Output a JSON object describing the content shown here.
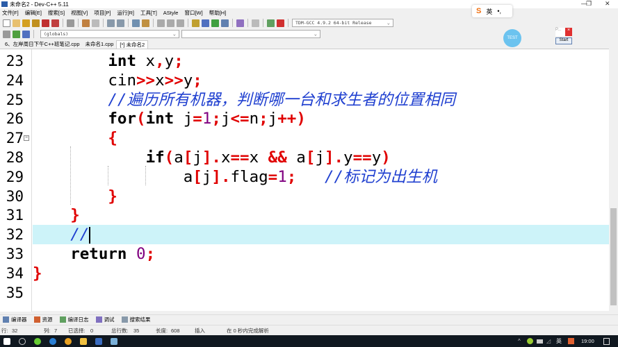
{
  "window": {
    "title": "未命名2 - Dev-C++ 5.11",
    "minimize": "—",
    "maximize": "❐",
    "close": "✕"
  },
  "menu": [
    "文件[F]",
    "编辑[E]",
    "搜索[S]",
    "视图[V]",
    "项目[P]",
    "运行[R]",
    "工具[T]",
    "AStyle",
    "窗口[W]",
    "帮助[H]"
  ],
  "toolbar": {
    "compiler": "TDM-GCC 4.9.2 64-bit Release",
    "scope": "(globals)"
  },
  "tabs": [
    {
      "label": "6、左岸周日下午C++班笔记.cpp",
      "active": false
    },
    {
      "label": "未命名1.cpp",
      "active": false
    },
    {
      "label": "[*] 未命名2",
      "active": true
    }
  ],
  "overlay": {
    "ime_mode": "英",
    "ime_dots": "•,",
    "test_label": "TEST",
    "mini_title": "P...",
    "mini_close": "×",
    "mini_start": "Start"
  },
  "editor": {
    "lines": [
      {
        "n": "23",
        "indent": 8,
        "tokens": [
          [
            "int",
            "kw"
          ],
          [
            " x",
            "id"
          ],
          [
            ",",
            "op"
          ],
          [
            "y",
            "id"
          ],
          [
            ";",
            "op"
          ]
        ]
      },
      {
        "n": "24",
        "indent": 8,
        "tokens": [
          [
            "cin",
            "id"
          ],
          [
            ">>",
            "op"
          ],
          [
            "x",
            "id"
          ],
          [
            ">>",
            "op"
          ],
          [
            "y",
            "id"
          ],
          [
            ";",
            "op"
          ]
        ]
      },
      {
        "n": "25",
        "indent": 8,
        "tokens": [
          [
            "//遍历所有机器，判断哪一台和求生者的位置相同",
            "cm"
          ]
        ]
      },
      {
        "n": "26",
        "indent": 8,
        "tokens": [
          [
            "for",
            "kw"
          ],
          [
            "(",
            "op"
          ],
          [
            "int",
            "kw"
          ],
          [
            " j",
            "id"
          ],
          [
            "=",
            "op"
          ],
          [
            "1",
            "num"
          ],
          [
            ";",
            "op"
          ],
          [
            "j",
            "id"
          ],
          [
            "<=",
            "op"
          ],
          [
            "n",
            "id"
          ],
          [
            ";",
            "op"
          ],
          [
            "j",
            "id"
          ],
          [
            "++",
            "op"
          ],
          [
            ")",
            "op"
          ]
        ]
      },
      {
        "n": "27",
        "indent": 8,
        "fold": true,
        "tokens": [
          [
            "{",
            "op"
          ]
        ]
      },
      {
        "n": "28",
        "indent": 12,
        "tokens": [
          [
            "if",
            "kw"
          ],
          [
            "(",
            "op"
          ],
          [
            "a",
            "id"
          ],
          [
            "[",
            "op"
          ],
          [
            "j",
            "id"
          ],
          [
            "]",
            "op"
          ],
          [
            ".",
            "op"
          ],
          [
            "x",
            "id"
          ],
          [
            "==",
            "op"
          ],
          [
            "x ",
            "id"
          ],
          [
            "&&",
            "op"
          ],
          [
            " a",
            "id"
          ],
          [
            "[",
            "op"
          ],
          [
            "j",
            "id"
          ],
          [
            "]",
            "op"
          ],
          [
            ".",
            "op"
          ],
          [
            "y",
            "id"
          ],
          [
            "==",
            "op"
          ],
          [
            "y",
            "id"
          ],
          [
            ")",
            "op"
          ]
        ]
      },
      {
        "n": "29",
        "indent": 16,
        "tokens": [
          [
            "a",
            "id"
          ],
          [
            "[",
            "op"
          ],
          [
            "j",
            "id"
          ],
          [
            "]",
            "op"
          ],
          [
            ".",
            "op"
          ],
          [
            "flag",
            "id"
          ],
          [
            "=",
            "op"
          ],
          [
            "1",
            "num"
          ],
          [
            ";",
            "op"
          ],
          [
            "   ",
            "id"
          ],
          [
            "//标记为出生机",
            "cm"
          ]
        ]
      },
      {
        "n": "30",
        "indent": 8,
        "tokens": [
          [
            "}",
            "op"
          ]
        ]
      },
      {
        "n": "31",
        "indent": 4,
        "tokens": [
          [
            "}",
            "op"
          ]
        ]
      },
      {
        "n": "32",
        "indent": 4,
        "current": true,
        "tokens": [
          [
            "//",
            "cm"
          ]
        ]
      },
      {
        "n": "33",
        "indent": 4,
        "tokens": [
          [
            "return",
            "kw"
          ],
          [
            " ",
            "id"
          ],
          [
            "0",
            "num"
          ],
          [
            ";",
            "op"
          ]
        ]
      },
      {
        "n": "34",
        "indent": 0,
        "tokens": [
          [
            "}",
            "op"
          ]
        ]
      },
      {
        "n": "35",
        "indent": 0,
        "tokens": []
      }
    ]
  },
  "bottom_tabs": [
    "编译器",
    "资源",
    "编译日志",
    "调试",
    "搜索结果"
  ],
  "status": {
    "row_label": "行:",
    "row": "32",
    "col_label": "列:",
    "col": "7",
    "sel_label": "已选择:",
    "sel": "0",
    "total_label": "总行数:",
    "total": "35",
    "len_label": "长度:",
    "len": "608",
    "mode": "插入",
    "parse": "在 0 秒内完成解析"
  },
  "taskbar": {
    "lang": "英",
    "time": "19:00"
  }
}
